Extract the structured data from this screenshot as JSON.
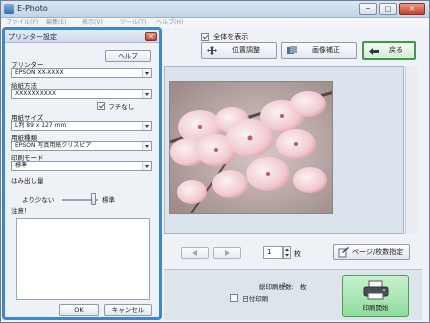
{
  "window": {
    "title": "E-Photo",
    "minimize": "─",
    "maximize": "□",
    "close": "✕"
  },
  "menu": [
    "ファイル(F)",
    "編集(E)",
    "表示(V)",
    "ツール(T)",
    "ヘルプ(H)"
  ],
  "toolbar": {
    "show_all_label": "全体を表示",
    "show_all_checked": true,
    "adjust_label": "位置調整",
    "correct_label": "画像補正",
    "back_label": "戻る"
  },
  "navigation": {
    "page_value": "1",
    "page_unit": "枚",
    "page_spec_label": "ページ/枚数指定"
  },
  "status": {
    "total_label": "総印刷枚数:",
    "total_value": "1",
    "total_unit": "枚",
    "date_print_label": "日付印刷",
    "date_print_checked": false,
    "print_button_label": "印刷開始"
  },
  "dialog": {
    "title": "プリンター設定",
    "close": "✕",
    "help_label": "ヘルプ",
    "printer_label": "プリンター",
    "printer_value": "EPSON XX-XXXX",
    "feed_label": "給紙方法",
    "feed_value": "XXXXXXXXXX",
    "borderless_label": "フチなし",
    "borderless_checked": true,
    "size_label": "用紙サイズ",
    "size_value": "L判 89 x 127 mm",
    "type_label": "用紙種類",
    "type_value": "EPSON 写真用紙クリスピア",
    "mode_label": "印刷モード",
    "mode_value": "標準",
    "overflow_label": "はみ出し量",
    "overflow_less": "より少ない",
    "overflow_standard": "標準",
    "notes_label": "注意！",
    "ok_label": "OK",
    "cancel_label": "キャンセル"
  },
  "colors": {
    "dialog_border": "#3c86d8",
    "back_button_border": "#3d9b4e",
    "print_button": "#8fdc9c"
  }
}
